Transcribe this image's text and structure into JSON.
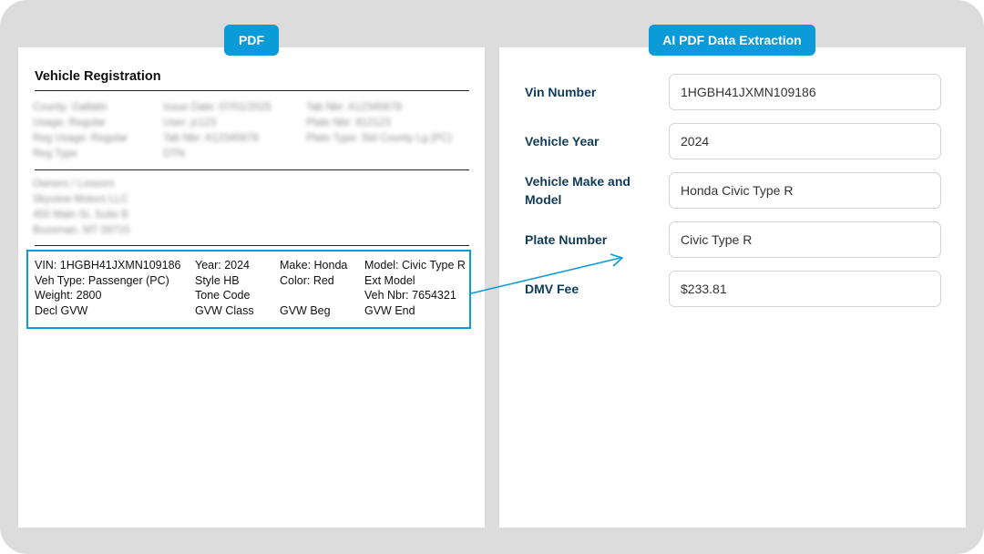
{
  "tags": {
    "pdf": "PDF",
    "ai": "AI PDF Data Extraction"
  },
  "document": {
    "title": "Vehicle Registration",
    "blurred": {
      "col1": [
        "County: Gallatin",
        "Usage: Regular",
        "Reg Usage: Regular",
        "Reg Type"
      ],
      "col2": [
        "Issue Date: 07/01/2025",
        "User: jc123",
        "Tab Nbr: A12345678",
        "DTN"
      ],
      "col3": [
        "Tab Nbr: A12345678",
        "Plate Nbr: 812123",
        "Plate Type: Std County Lg (PC)"
      ],
      "owners": [
        "Owners / Lessors",
        "Skyview Motors LLC",
        "450 Main St, Suite B",
        "Bozeman, MT 59715"
      ]
    },
    "vehicle": {
      "col1": [
        "VIN: 1HGBH41JXMN109186",
        "Veh Type: Passenger (PC)",
        "Weight: 2800",
        "Decl GVW"
      ],
      "col2": [
        "Year: 2024",
        "Style HB",
        "Tone Code",
        "GVW Class"
      ],
      "col3": [
        "Make: Honda",
        "Color: Red",
        "",
        "GVW Beg"
      ],
      "col4": [
        "Model: Civic Type R",
        "Ext Model",
        "Veh Nbr: 7654321",
        "GVW End"
      ]
    }
  },
  "fields": [
    {
      "label": "Vin Number",
      "value": "1HGBH41JXMN109186"
    },
    {
      "label": "Vehicle Year",
      "value": "2024"
    },
    {
      "label": "Vehicle Make and Model",
      "value": "Honda Civic Type R"
    },
    {
      "label": "Plate Number",
      "value": "Civic Type R"
    },
    {
      "label": "DMV Fee",
      "value": "$233.81"
    }
  ],
  "colors": {
    "accent": "#0b9bd9",
    "label": "#0e3b5a",
    "frame": "#dcdcdc"
  }
}
